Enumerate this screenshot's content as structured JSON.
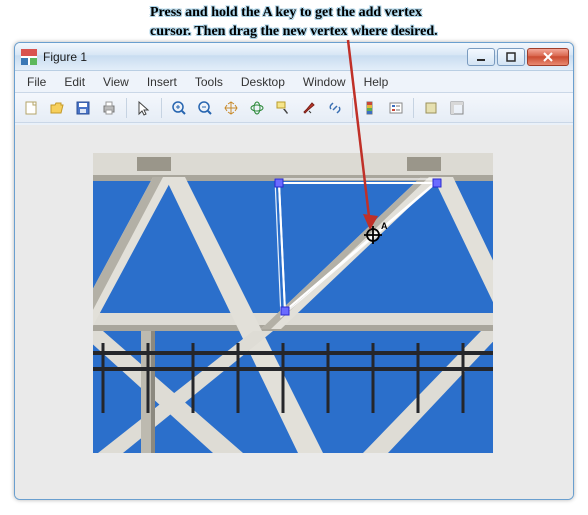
{
  "annotation": {
    "line1": "Press and hold the A key to get the add vertex",
    "line2": "cursor. Then drag the new vertex where desired."
  },
  "window": {
    "title": "Figure 1"
  },
  "menu": {
    "file": "File",
    "edit": "Edit",
    "view": "View",
    "insert": "Insert",
    "tools": "Tools",
    "desktop": "Desktop",
    "window": "Window",
    "help": "Help"
  },
  "toolbar": {
    "new": "new-figure",
    "open": "open",
    "save": "save",
    "print": "print",
    "pointer": "edit-plot",
    "zoomin": "zoom-in",
    "zoomout": "zoom-out",
    "pan": "pan",
    "rotate": "rotate-3d",
    "datacursor": "data-cursor",
    "brush": "brush",
    "link": "link",
    "colorbar": "insert-colorbar",
    "legend": "insert-legend",
    "hide": "hide-plot-tools",
    "show": "show-plot-tools"
  },
  "colors": {
    "sky": "#2b6fcb",
    "beam": "#e6e4de",
    "beamshade": "#a9a69c",
    "rail": "#2f2f2f",
    "roi": "#ffffff",
    "roivertex": "#6b6bff",
    "arrow": "#c03028"
  }
}
